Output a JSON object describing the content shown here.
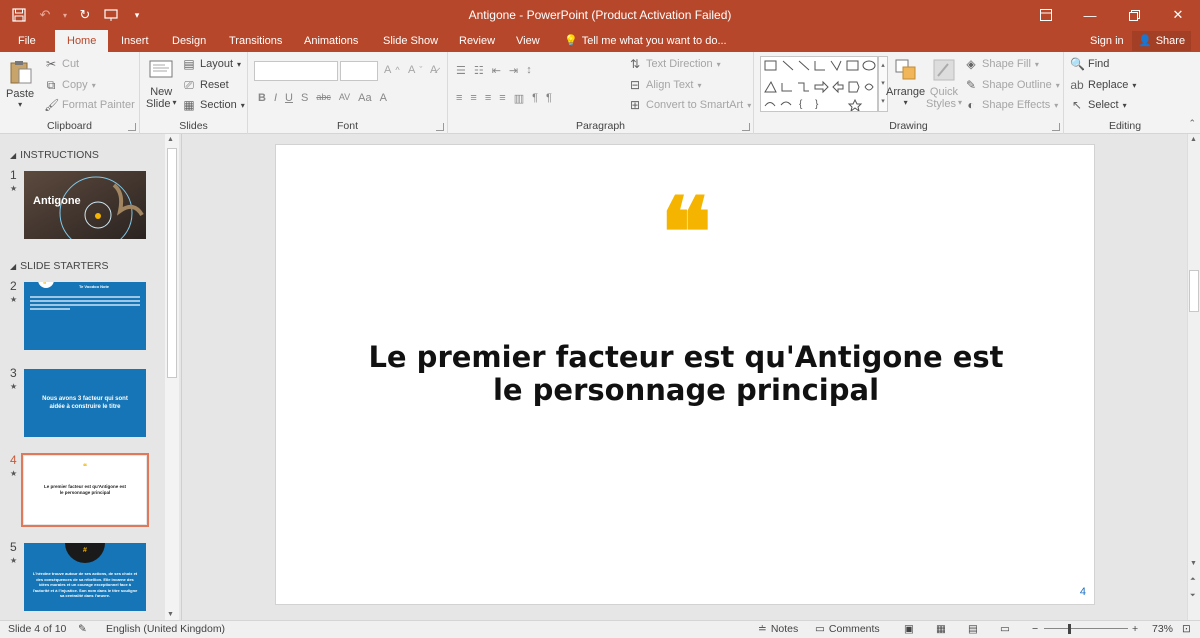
{
  "window": {
    "title": "Antigone - PowerPoint (Product Activation Failed)"
  },
  "tabs": [
    {
      "label": "File"
    },
    {
      "label": "Home"
    },
    {
      "label": "Insert"
    },
    {
      "label": "Design"
    },
    {
      "label": "Transitions"
    },
    {
      "label": "Animations"
    },
    {
      "label": "Slide Show"
    },
    {
      "label": "Review"
    },
    {
      "label": "View"
    }
  ],
  "tellme": "Tell me what you want to do...",
  "signin": "Sign in",
  "share": "Share",
  "ribbon": {
    "clipboard": {
      "label": "Clipboard",
      "paste": "Paste",
      "cut": "Cut",
      "copy": "Copy",
      "format_painter": "Format Painter"
    },
    "slides": {
      "label": "Slides",
      "new_slide": "New",
      "new_slide2": "Slide",
      "layout": "Layout",
      "reset": "Reset",
      "section": "Section"
    },
    "font": {
      "label": "Font"
    },
    "paragraph": {
      "label": "Paragraph",
      "text_direction": "Text Direction",
      "align_text": "Align Text",
      "convert": "Convert to SmartArt"
    },
    "drawing": {
      "label": "Drawing",
      "arrange": "Arrange",
      "quick": "Quick",
      "styles": "Styles",
      "shape_fill": "Shape Fill",
      "shape_outline": "Shape Outline",
      "shape_effects": "Shape Effects"
    },
    "editing": {
      "label": "Editing",
      "find": "Find",
      "replace": "Replace",
      "select": "Select"
    }
  },
  "panel": {
    "sections": [
      "INSTRUCTIONS",
      "SLIDE STARTERS"
    ],
    "slides": [
      {
        "num": "1",
        "title": "Antigone"
      },
      {
        "num": "2",
        "title": "Te Voodoo Note"
      },
      {
        "num": "3",
        "title": "Nous avons 3 facteur qui sont aidée à construire le titre"
      },
      {
        "num": "4",
        "title": "Le premier facteur est qu'Antigone est le personnage principal"
      },
      {
        "num": "5",
        "title": "L'héroïne trouve autour de ses actions, de ses choix et des conséquences de sa rébellion. Elle incarne des idées morales et un courage exceptionnel face à l'autorité et à l'injustice. Son nom dans le titre souligne sa centralité dans l'œuvre."
      }
    ]
  },
  "slide": {
    "quote_mark": "❝",
    "text_line1": "Le premier facteur est qu'Antigone est",
    "text_line2": "le personnage principal",
    "page_number": "4"
  },
  "status": {
    "slide_of": "Slide 4 of 10",
    "language": "English (United Kingdom)",
    "notes": "Notes",
    "comments": "Comments",
    "zoom": "73%"
  },
  "colors": {
    "accent": "#b7472a",
    "quote": "#f4b400",
    "thumb_blue": "#1575b6"
  }
}
